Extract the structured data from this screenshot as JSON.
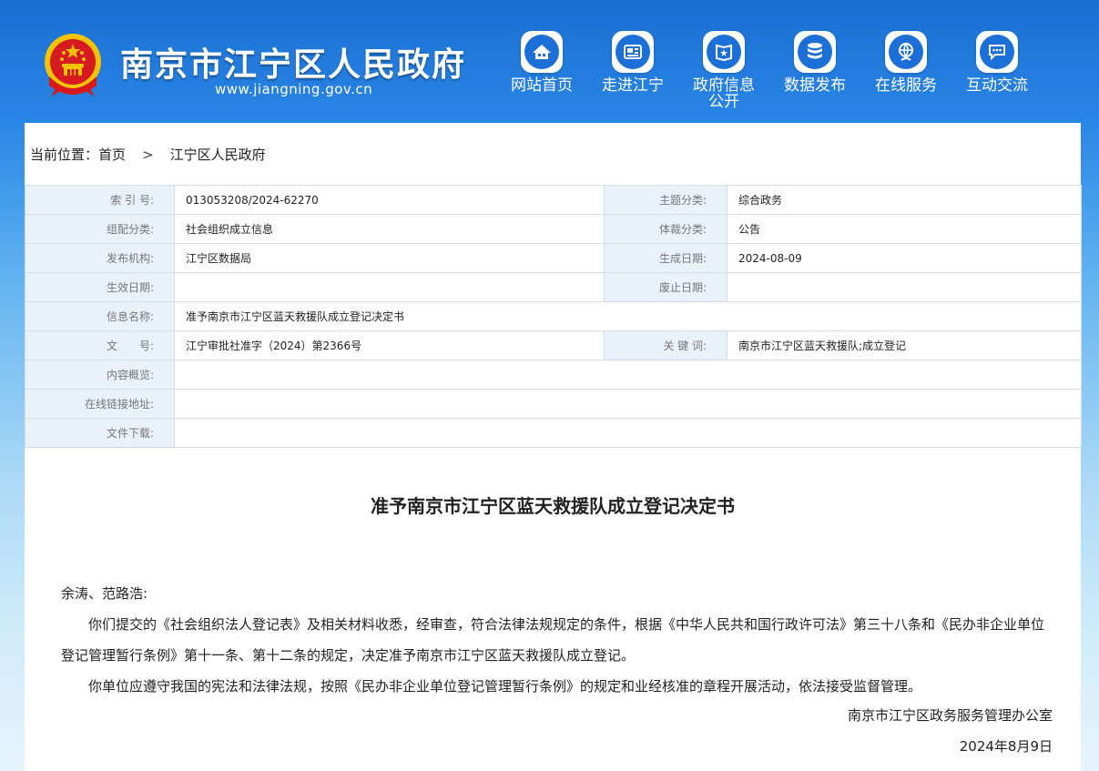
{
  "header": {
    "site_title": "南京市江宁区人民政府",
    "site_domain": "www.jiangning.gov.cn",
    "nav": [
      {
        "label": "网站首页",
        "icon": "home-icon"
      },
      {
        "label": "走进江宁",
        "icon": "news-icon"
      },
      {
        "label": "政府信息公开",
        "icon": "gov-info-book-icon"
      },
      {
        "label": "数据发布",
        "icon": "database-icon"
      },
      {
        "label": "在线服务",
        "icon": "online-service-icon"
      },
      {
        "label": "互动交流",
        "icon": "chat-icon"
      }
    ],
    "nav_gov_line1": "政府信息",
    "nav_gov_line2": "公开"
  },
  "breadcrumb": {
    "prefix": "当前位置：",
    "home": "首页",
    "separator": ">",
    "current": "江宁区人民政府"
  },
  "meta": {
    "index_label": "索 引 号:",
    "index_value": "013053208/2024-62270",
    "topic_label": "主题分类:",
    "topic_value": "综合政务",
    "org_cat_label": "组配分类:",
    "org_cat_value": "社会组织成立信息",
    "genre_label": "体裁分类:",
    "genre_value": "公告",
    "publisher_label": "发布机构:",
    "publisher_value": "江宁区数据局",
    "created_label": "生成日期:",
    "created_value": "2024-08-09",
    "effective_label": "生效日期:",
    "effective_value": "",
    "abolish_label": "废止日期:",
    "abolish_value": "",
    "name_label": "信息名称:",
    "name_value": "准予南京市江宁区蓝天救援队成立登记决定书",
    "docno_label": "文　　号:",
    "docno_value": "江宁审批社准字（2024）第2366号",
    "keywords_label": "关 键 词:",
    "keywords_value": "南京市江宁区蓝天救援队;成立登记",
    "overview_label": "内容概览:",
    "overview_value": "",
    "link_label": "在线链接地址:",
    "link_value": "",
    "download_label": "文件下载:",
    "download_value": ""
  },
  "document": {
    "title": "准予南京市江宁区蓝天救援队成立登记决定书",
    "salutation": "余涛、范路浩:",
    "para1": "你们提交的《社会组织法人登记表》及相关材料收悉，经审查，符合法律法规规定的条件，根据《中华人民共和国行政许可法》第三十八条和《民办非企业单位登记管理暂行条例》第十一条、第十二条的规定，决定准予南京市江宁区蓝天救援队成立登记。",
    "para2": "你单位应遵守我国的宪法和法律法规，按照《民办非企业单位登记管理暂行条例》的规定和业经核准的章程开展活动，依法接受监督管理。",
    "signature_org": "南京市江宁区政务服务管理办公室",
    "signature_date": "2024年8月9日"
  },
  "colors": {
    "header_blue": "#1a6fd1",
    "icon_blue": "#1c6fd6",
    "meta_key_bg": "#e9f1fa",
    "border": "#d6dde6"
  }
}
